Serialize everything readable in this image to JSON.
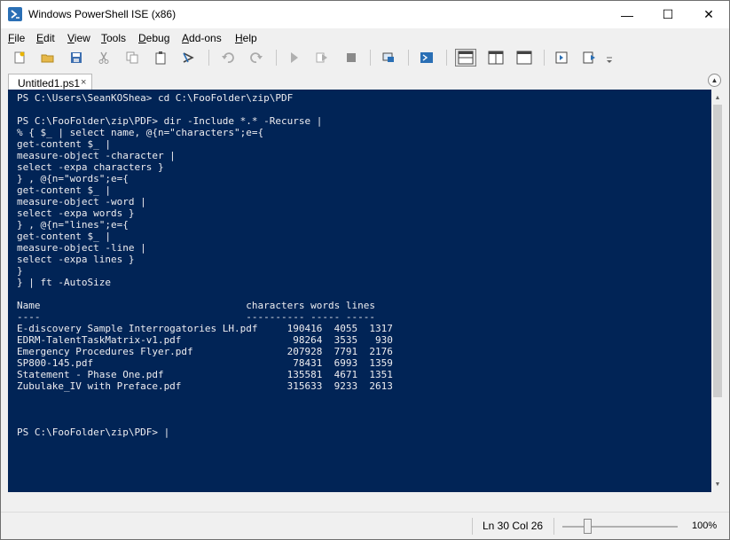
{
  "window": {
    "title": "Windows PowerShell ISE (x86)",
    "minimize": "—",
    "maximize": "☐",
    "close": "✕"
  },
  "menu": [
    {
      "accel": "F",
      "rest": "ile"
    },
    {
      "accel": "E",
      "rest": "dit"
    },
    {
      "accel": "V",
      "rest": "iew"
    },
    {
      "accel": "T",
      "rest": "ools"
    },
    {
      "accel": "D",
      "rest": "ebug"
    },
    {
      "accel": "A",
      "rest": "dd-ons"
    },
    {
      "accel": "H",
      "rest": "elp"
    }
  ],
  "toolbar": {
    "icons": [
      "new-script-icon",
      "open-icon",
      "save-icon",
      "cut-icon",
      "copy-icon",
      "paste-icon",
      "run-command-icon",
      "undo-icon",
      "redo-icon",
      "run-script-icon",
      "run-selection-icon",
      "stop-icon",
      "remote-powershell-icon",
      "powershell-console-icon",
      "show-script-top-icon",
      "show-script-right-icon",
      "show-script-maximized-icon",
      "show-command-window-icon",
      "show-command-addon-icon",
      "customize-toolbar-icon"
    ],
    "active": "show-script-top-icon"
  },
  "tab": {
    "label": "Untitled1.ps1",
    "close": "×",
    "collapse": "▲"
  },
  "console": {
    "lines": [
      "PS C:\\Users\\SeanKOShea> cd C:\\FooFolder\\zip\\PDF",
      "",
      "PS C:\\FooFolder\\zip\\PDF> dir -Include *.* -Recurse |",
      "% { $_ | select name, @{n=\"characters\";e={",
      "get-content $_ |",
      "measure-object -character |",
      "select -expa characters }",
      "} , @{n=\"words\";e={",
      "get-content $_ |",
      "measure-object -word |",
      "select -expa words }",
      "} , @{n=\"lines\";e={",
      "get-content $_ |",
      "measure-object -line |",
      "select -expa lines }",
      "}",
      "} | ft -AutoSize",
      "",
      "Name                                   characters words lines",
      "----                                   ---------- ----- -----",
      "E-discovery Sample Interrogatories LH.pdf     190416  4055  1317",
      "EDRM-TalentTaskMatrix-v1.pdf                   98264  3535   930",
      "Emergency Procedures Flyer.pdf                207928  7791  2176",
      "SP800-145.pdf                                  78431  6993  1359",
      "Statement - Phase One.pdf                     135581  4671  1351",
      "Zubulake_IV with Preface.pdf                  315633  9233  2613",
      "",
      "",
      "",
      "PS C:\\FooFolder\\zip\\PDF> |"
    ]
  },
  "status": {
    "position": "Ln 30  Col 26",
    "zoom": "100%",
    "zoom_level_percent": 100
  }
}
